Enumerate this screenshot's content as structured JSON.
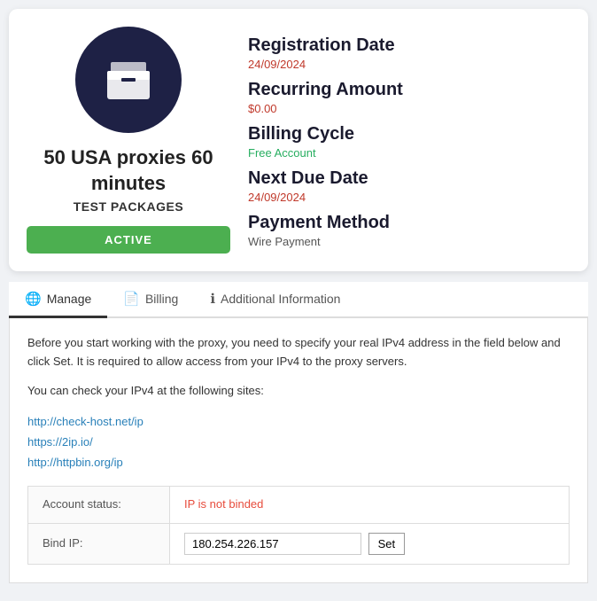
{
  "card": {
    "product_name": "50 USA proxies 60 minutes",
    "product_tag": "TEST PACKAGES",
    "status": "ACTIVE",
    "registration_label": "Registration Date",
    "registration_date": "24/09/2024",
    "recurring_label": "Recurring Amount",
    "recurring_value": "$0.00",
    "billing_label": "Billing Cycle",
    "billing_value": "Free Account",
    "next_due_label": "Next Due Date",
    "next_due_date": "24/09/2024",
    "payment_method_label": "Payment Method",
    "payment_method_value": "Wire Payment"
  },
  "tabs": [
    {
      "id": "manage",
      "label": "Manage",
      "icon": "🌐",
      "active": true
    },
    {
      "id": "billing",
      "label": "Billing",
      "icon": "📄",
      "active": false
    },
    {
      "id": "additional",
      "label": "Additional Information",
      "icon": "ℹ",
      "active": false
    }
  ],
  "manage": {
    "description": "Before you start working with the proxy, you need to specify your real IPv4 address in the field below and click Set. It is required to allow access from your IPv4 to the proxy servers.",
    "check_text": "You can check your IPv4 at the following sites:",
    "links": [
      {
        "url": "http://check-host.net/ip",
        "label": "http://check-host.net/ip"
      },
      {
        "url": "https://2ip.io/",
        "label": "https://2ip.io/"
      },
      {
        "url": "http://httpbin.org/ip",
        "label": "http://httpbin.org/ip"
      }
    ],
    "account_status_label": "Account status:",
    "account_status_value": "IP is not binded",
    "bind_ip_label": "Bind IP:",
    "bind_ip_value": "180.254.226.157",
    "set_button": "Set"
  }
}
